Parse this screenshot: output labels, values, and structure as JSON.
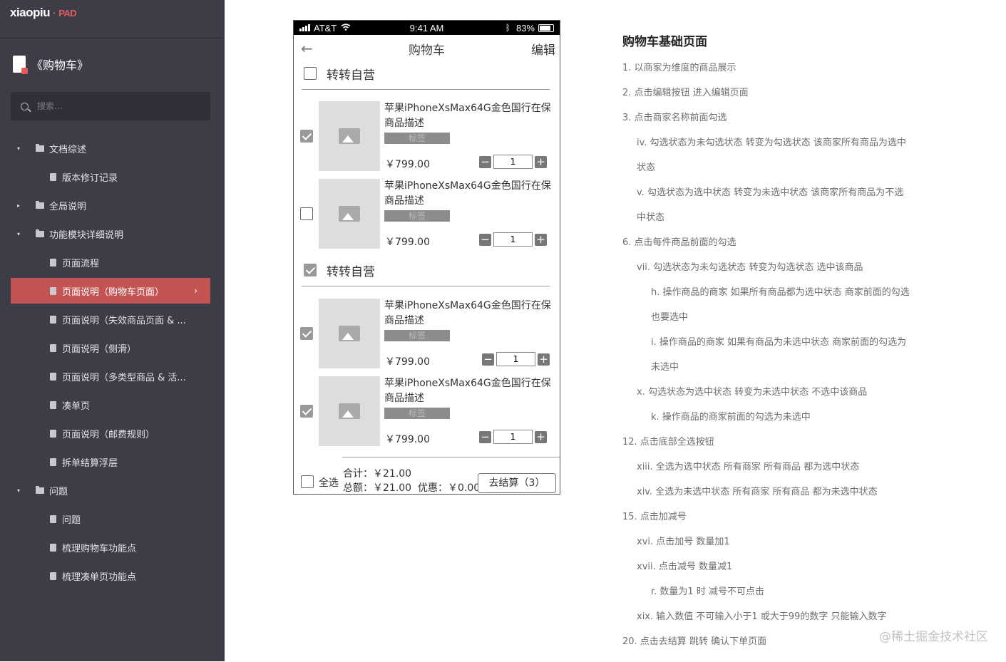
{
  "sidebar": {
    "logo_main": "xiaopiu",
    "logo_dot": "·",
    "logo_pad": "PAD",
    "project_title": "《购物车》",
    "search_placeholder": "搜索...",
    "items": [
      {
        "label": "文档综述",
        "type": "folder",
        "level": 0,
        "expanded": true
      },
      {
        "label": "版本修订记录",
        "type": "page",
        "level": 1
      },
      {
        "label": "全局说明",
        "type": "folder",
        "level": 0,
        "expanded": false
      },
      {
        "label": "功能模块详细说明",
        "type": "folder",
        "level": 0,
        "expanded": true
      },
      {
        "label": "页面流程",
        "type": "page",
        "level": 1
      },
      {
        "label": "页面说明（购物车页面）",
        "type": "page",
        "level": 1,
        "active": true
      },
      {
        "label": "页面说明（失效商品页面 & ...",
        "type": "page",
        "level": 1
      },
      {
        "label": "页面说明（侧滑）",
        "type": "page",
        "level": 1
      },
      {
        "label": "页面说明（多类型商品 & 活...",
        "type": "page",
        "level": 1
      },
      {
        "label": "凑单页",
        "type": "page",
        "level": 1
      },
      {
        "label": "页面说明（邮费规则）",
        "type": "page",
        "level": 1
      },
      {
        "label": "拆单结算浮层",
        "type": "page",
        "level": 1
      },
      {
        "label": "问题",
        "type": "folder",
        "level": 0,
        "expanded": true
      },
      {
        "label": "问题",
        "type": "page",
        "level": 1
      },
      {
        "label": "梳理购物车功能点",
        "type": "page",
        "level": 1
      },
      {
        "label": "梳理凑单页功能点",
        "type": "page",
        "level": 1
      }
    ]
  },
  "phone": {
    "status": {
      "carrier": "AT&T",
      "time": "9:41 AM",
      "battery": "83%"
    },
    "nav": {
      "back_icon": "arrow-left-icon",
      "title": "购物车",
      "edit": "编辑"
    },
    "shops": [
      {
        "name": "转转自营",
        "checked": false
      },
      {
        "name": "转转自营",
        "checked": true
      }
    ],
    "products": [
      {
        "title": "苹果iPhoneXsMax64G金色国行在保商品描述",
        "tag": "标签",
        "price": "￥799.00",
        "qty": "1",
        "checked": true
      },
      {
        "title": "苹果iPhoneXsMax64G金色国行在保商品描述",
        "tag": "标签",
        "price": "￥799.00",
        "qty": "1",
        "checked": false
      },
      {
        "title": "苹果iPhoneXsMax64G金色国行在保商品描述",
        "tag": "标签",
        "price": "￥799.00",
        "qty": "1",
        "checked": true
      },
      {
        "title": "苹果iPhoneXsMax64G金色国行在保商品描述",
        "tag": "标签",
        "price": "￥799.00",
        "qty": "1",
        "checked": true
      }
    ],
    "footer": {
      "select_all": "全选",
      "sum": "合计：￥21.00",
      "total": "总额：￥21.00",
      "discount": "优惠：￥0.00",
      "checkout": "去结算（3）"
    }
  },
  "notes": {
    "title": "购物车基础页面",
    "lines": [
      {
        "text": "1. 以商家为维度的商品展示",
        "level": 1
      },
      {
        "text": "2. 点击编辑按钮 进入编辑页面",
        "level": 1
      },
      {
        "text": "3. 点击商家名称前面勾选",
        "level": 1
      },
      {
        "text": "iv. 勾选状态为未勾选状态 转变为勾选状态 该商家所有商品为选中",
        "level": 2
      },
      {
        "text": "状态",
        "level": 2
      },
      {
        "text": "v. 勾选状态为选中状态 转变为未选中状态 该商家所有商品为不选",
        "level": 2
      },
      {
        "text": "中状态",
        "level": 2
      },
      {
        "text": "6. 点击每件商品前面的勾选",
        "level": 1
      },
      {
        "text": "vii. 勾选状态为未勾选状态 转变为勾选状态 选中该商品",
        "level": 2
      },
      {
        "text": "h. 操作商品的商家 如果所有商品都为选中状态 商家前面的勾选",
        "level": 3
      },
      {
        "text": "也要选中",
        "level": 3
      },
      {
        "text": "i. 操作商品的商家 如果有商品为未选中状态 商家前面的勾选为",
        "level": 3
      },
      {
        "text": "未选中",
        "level": 3
      },
      {
        "text": "x. 勾选状态为选中状态 转变为未选中状态 不选中该商品",
        "level": 2
      },
      {
        "text": "k. 操作商品的商家前面的勾选为未选中",
        "level": 3
      },
      {
        "text": "12. 点击底部全选按钮",
        "level": 1
      },
      {
        "text": "xiii. 全选为选中状态 所有商家 所有商品 都为选中状态",
        "level": 2
      },
      {
        "text": "xiv. 全选为未选中状态 所有商家 所有商品 都为未选中状态",
        "level": 2
      },
      {
        "text": "15. 点击加减号",
        "level": 1
      },
      {
        "text": "xvi. 点击加号 数量加1",
        "level": 2
      },
      {
        "text": "xvii. 点击减号 数量减1",
        "level": 2
      },
      {
        "text": "r. 数量为1 时 减号不可点击",
        "level": 3
      },
      {
        "text": "xix. 输入数值 不可输入小于1 或大于99的数字 只能输入数字",
        "level": 2
      },
      {
        "text": "20. 点击去结算 跳转 确认下单页面",
        "level": 1
      }
    ]
  },
  "watermark": "@稀土掘金技术社区",
  "colors": {
    "sidebar_bg": "#3d3d47",
    "active_item": "#c45454",
    "accent": "#e35b5b"
  }
}
